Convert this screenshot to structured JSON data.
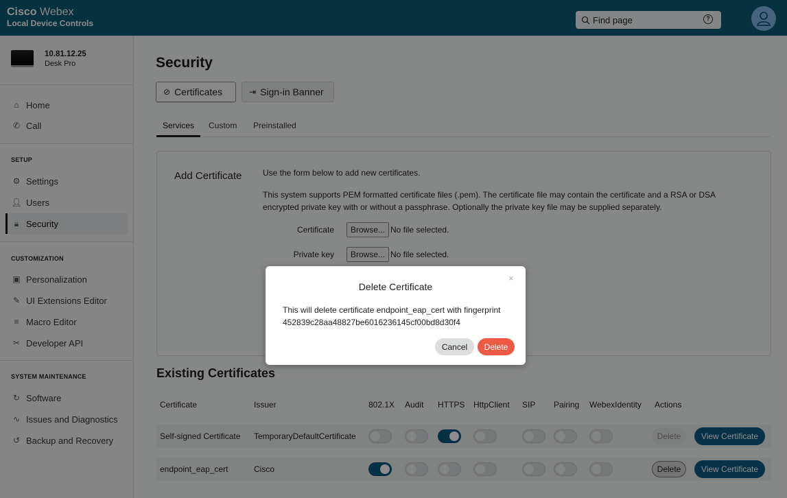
{
  "header": {
    "brand_name": "Cisco",
    "brand_product": "Webex",
    "subtitle": "Local Device Controls",
    "search_placeholder": "Find page",
    "help_glyph": "?"
  },
  "sidebar": {
    "device_ip": "10.81.12.25",
    "device_model": "Desk Pro",
    "items": {
      "home": "Home",
      "call": "Call",
      "setup_title": "SETUP",
      "settings": "Settings",
      "users": "Users",
      "security": "Security",
      "customization_title": "CUSTOMIZATION",
      "personalization": "Personalization",
      "ui_extensions": "UI Extensions Editor",
      "macro_editor": "Macro Editor",
      "developer_api": "Developer API",
      "maintenance_title": "SYSTEM MAINTENANCE",
      "software": "Software",
      "issues": "Issues and Diagnostics",
      "backup": "Backup and Recovery"
    }
  },
  "main": {
    "title": "Security",
    "tabs": [
      "Certificates",
      "Sign-in Banner"
    ],
    "subtabs": [
      "Services",
      "Custom",
      "Preinstalled"
    ],
    "add_cert": {
      "title": "Add Certificate",
      "line1": "Use the form below to add new certificates.",
      "line2": "This system supports PEM formatted certificate files (.pem). The certificate file may contain the certificate and a RSA or DSA",
      "line3": "encrypted private key with or without a passphrase. Optionally the private key file may be supplied separately.",
      "cert_label": "Certificate",
      "key_label": "Private key",
      "browse": "Browse...",
      "no_file": "No file selected."
    },
    "existing": {
      "title": "Existing Certificates",
      "columns": [
        "Certificate",
        "Issuer",
        "802.1X",
        "Audit",
        "HTTPS",
        "HttpClient",
        "SIP",
        "Pairing",
        "WebexIdentity",
        "Actions"
      ],
      "rows": [
        {
          "certificate": "Self-signed Certificate",
          "issuer": "TemporaryDefaultCertificate",
          "toggles": [
            false,
            false,
            true,
            false,
            false,
            false,
            false
          ]
        },
        {
          "certificate": "endpoint_eap_cert",
          "issuer": "Cisco",
          "toggles": [
            true,
            false,
            false,
            false,
            false,
            false,
            false
          ]
        }
      ],
      "delete_label": "Delete",
      "view_label": "View Certificate"
    }
  },
  "modal": {
    "title": "Delete Certificate",
    "close": "×",
    "body_line1": "This will delete certificate endpoint_eap_cert with fingerprint",
    "body_line2": "452839c28aa48827be6016236145cf00bd8d30f4",
    "cancel": "Cancel",
    "delete": "Delete"
  },
  "colors": {
    "header": "#0b5a73",
    "primary_button": "#0b5a80",
    "danger_button": "#ee5b44",
    "toggle_on": "#0c5a7e"
  }
}
